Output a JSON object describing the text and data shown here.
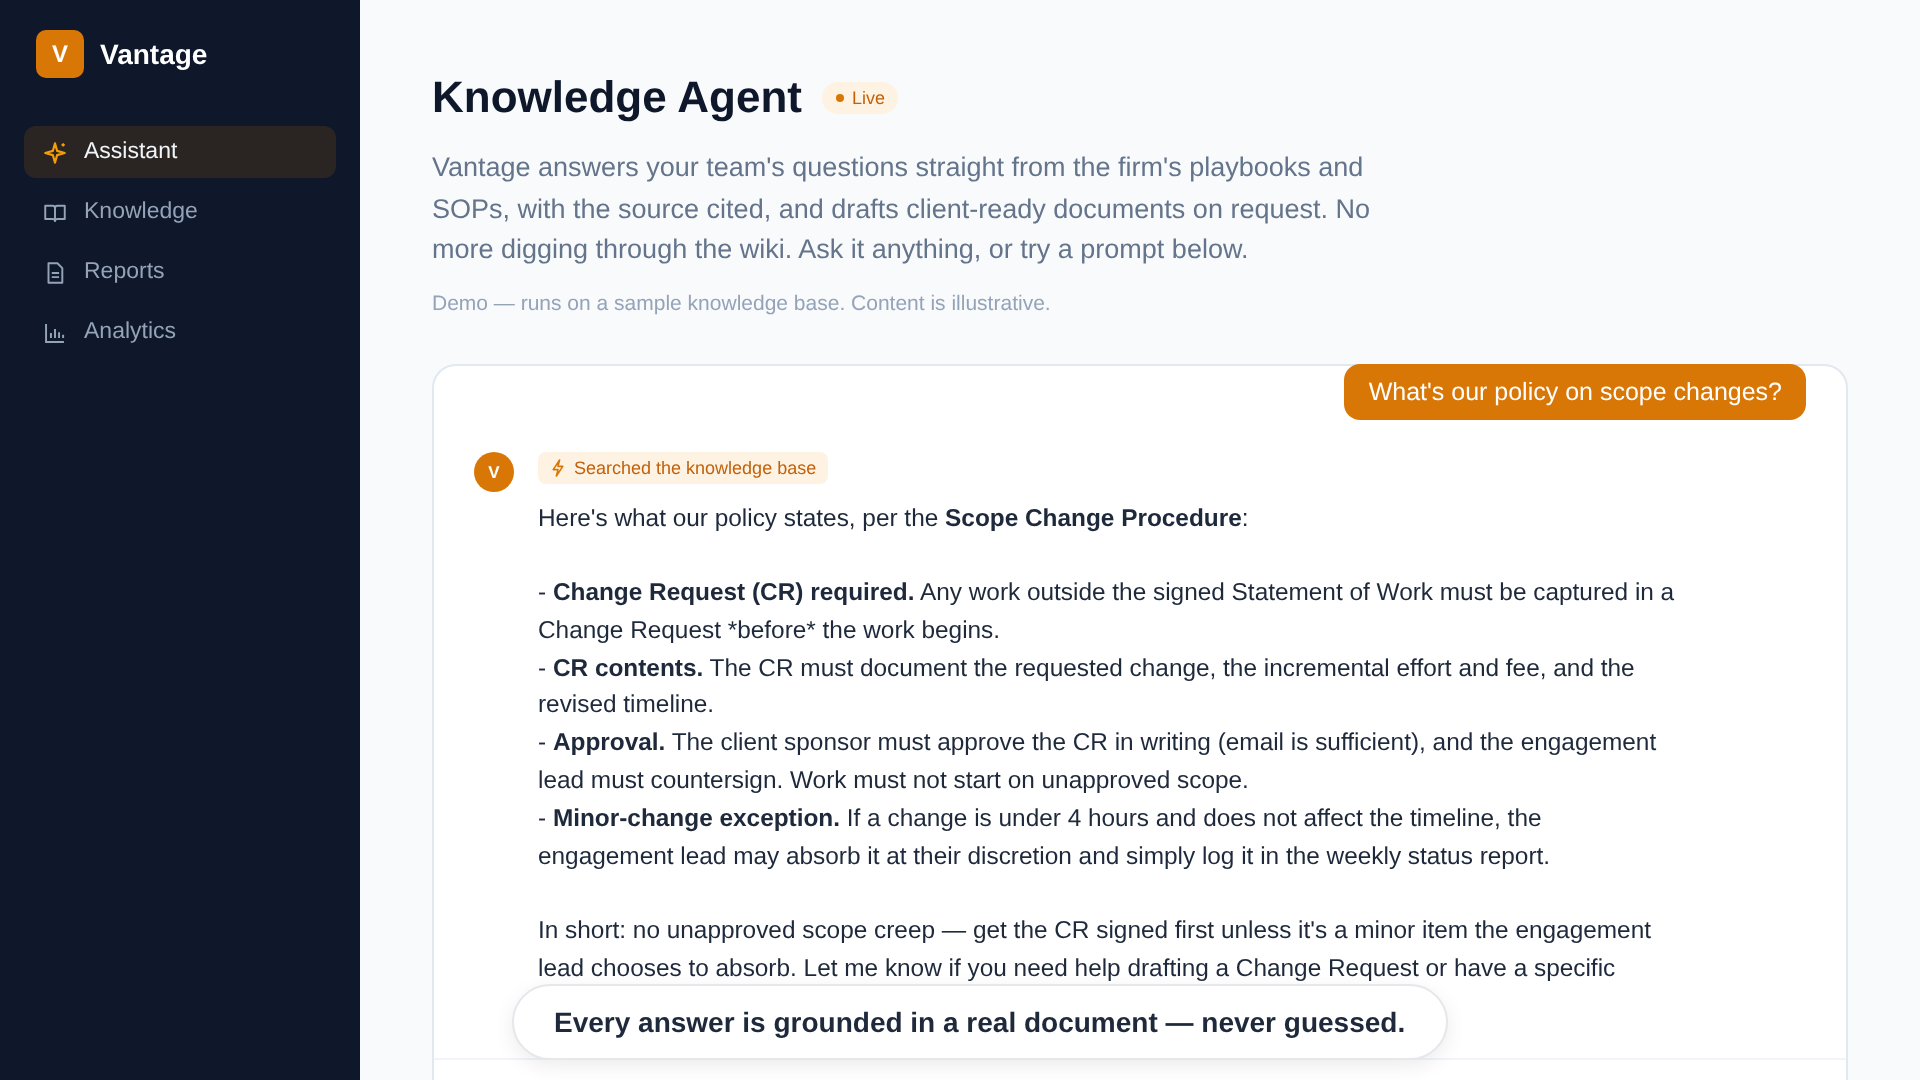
{
  "brand": {
    "initial": "V",
    "name": "Vantage"
  },
  "sidebar": {
    "items": [
      {
        "label": "Assistant",
        "selected": true
      },
      {
        "label": "Knowledge",
        "selected": false
      },
      {
        "label": "Reports",
        "selected": false
      },
      {
        "label": "Analytics",
        "selected": false
      }
    ]
  },
  "header": {
    "title": "Knowledge Agent",
    "badge": "Live",
    "description": "Vantage answers your team's questions straight from the firm's playbooks and SOPs, with the source cited, and drafts client-ready documents on request. No more digging through the wiki. Ask it anything, or try a prompt below.",
    "note": "Demo — runs on a sample knowledge base. Content is illustrative."
  },
  "chat": {
    "user_message": "What's our policy on scope changes?",
    "assistant": {
      "avatar": "V",
      "tool_badge": "Searched the knowledge base",
      "paragraphs": [
        {
          "kind": "text",
          "parts": [
            {
              "text": "Here's what our policy states, per the ",
              "bold": false
            },
            {
              "text": "Scope Change Procedure",
              "bold": true
            },
            {
              "text": ":",
              "bold": false
            }
          ]
        },
        {
          "kind": "bullet",
          "parts": [
            {
              "text": "- ",
              "bold": false
            },
            {
              "text": "Change Request (CR) required.",
              "bold": true
            },
            {
              "text": " Any work outside the signed Statement of Work must be captured in a Change Request *before* the work begins.",
              "bold": false
            }
          ]
        },
        {
          "kind": "bullet",
          "parts": [
            {
              "text": "- ",
              "bold": false
            },
            {
              "text": "CR contents.",
              "bold": true
            },
            {
              "text": " The CR must document the requested change, the incremental effort and fee, and the revised timeline.",
              "bold": false
            }
          ]
        },
        {
          "kind": "bullet",
          "parts": [
            {
              "text": "- ",
              "bold": false
            },
            {
              "text": "Approval.",
              "bold": true
            },
            {
              "text": " The client sponsor must approve the CR in writing (email is sufficient), and the engagement lead must countersign. Work must not start on unapproved scope.",
              "bold": false
            }
          ]
        },
        {
          "kind": "bullet",
          "parts": [
            {
              "text": "- ",
              "bold": false
            },
            {
              "text": "Minor-change exception.",
              "bold": true
            },
            {
              "text": " If a change is under 4 hours and does not affect the timeline, the engagement lead may absorb it at their discretion and simply log it in the weekly status report.",
              "bold": false
            }
          ]
        },
        {
          "kind": "text",
          "parts": [
            {
              "text": "In short: no unapproved scope creep — get the CR signed first unless it's a minor item the engagement lead chooses to absorb. Let me know if you need help drafting a Change Request or have a specific",
              "bold": false
            }
          ]
        }
      ]
    }
  },
  "banner": "Every answer is grounded in a real document — never guessed."
}
